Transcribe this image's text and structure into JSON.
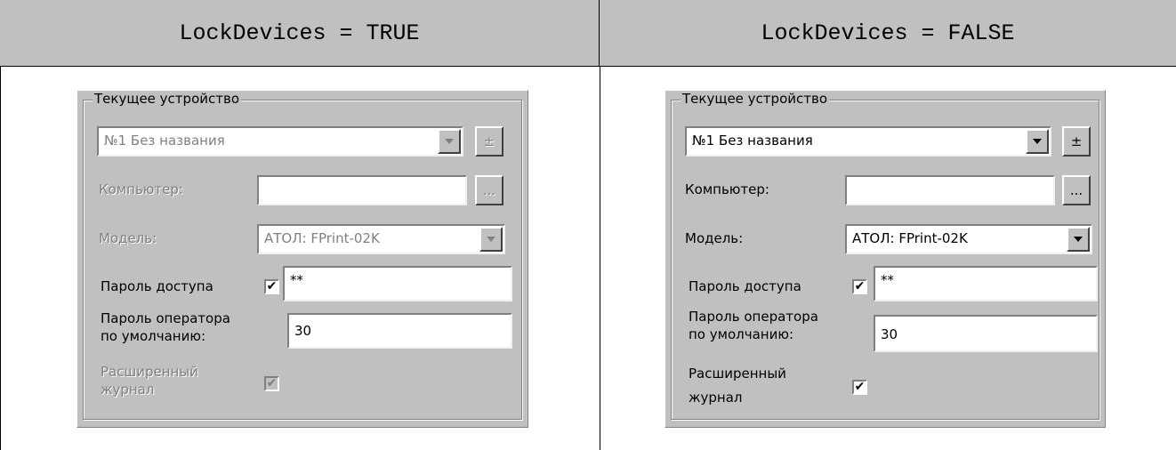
{
  "columns": [
    {
      "heading": "LockDevices = TRUE",
      "state": "locked"
    },
    {
      "heading": "LockDevices = FALSE",
      "state": "unlocked"
    }
  ],
  "panel": {
    "group_title": "Текущее устройство",
    "device_value": "№1 Без названия",
    "plus_minus_label": "±",
    "computer_label": "Компьютер:",
    "computer_value": "",
    "browse_label": "...",
    "model_label": "Модель:",
    "model_value": "АТОЛ: FPrint-02K",
    "access_password_label": "Пароль доступа",
    "access_password_checked": "✔",
    "access_password_value": "**",
    "operator_password_label_line1": "Пароль оператора",
    "operator_password_label_line2": "по умолчанию:",
    "operator_password_value": "30",
    "extended_log_label_line1": "Расширенный",
    "extended_log_label_line2": "журнал",
    "extended_log_checked": "✔"
  },
  "colors": {
    "window_bg": "#c0c0c0",
    "disabled_text": "#808080",
    "field_bg": "#ffffff"
  },
  "icons": {
    "dropdown": "chevron-down-icon",
    "check": "check-icon"
  }
}
